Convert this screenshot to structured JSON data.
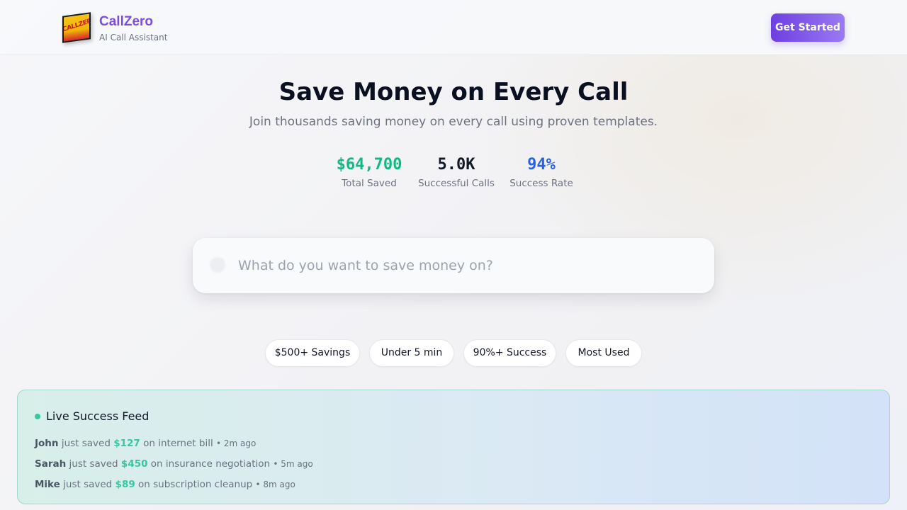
{
  "header": {
    "brand_name": "CallZero",
    "brand_tagline": "AI Call Assistant",
    "logo_text": "CALLZERO",
    "cta_label": "Get Started"
  },
  "hero": {
    "title": "Save Money on Every Call",
    "subtitle": "Join thousands saving money on every call using proven templates."
  },
  "stats": [
    {
      "value": "$64,700",
      "label": "Total Saved",
      "color": "#10b981"
    },
    {
      "value": "5.0K",
      "label": "Successful Calls",
      "color": "#111827"
    },
    {
      "value": "94%",
      "label": "Success Rate",
      "color": "#2563eb"
    }
  ],
  "search": {
    "placeholder": "What do you want to save money on?",
    "icon": "search-icon"
  },
  "filters": [
    {
      "label": "$500+ Savings"
    },
    {
      "label": "Under 5 min"
    },
    {
      "label": "90%+ Success"
    },
    {
      "label": "Most Used"
    }
  ],
  "feed": {
    "title": "Live Success Feed",
    "items": [
      {
        "name": "John",
        "verb": "just saved",
        "amount": "$127",
        "what": "on internet bill",
        "time": "• 2m ago"
      },
      {
        "name": "Sarah",
        "verb": "just saved",
        "amount": "$450",
        "what": "on insurance negotiation",
        "time": "• 5m ago"
      },
      {
        "name": "Mike",
        "verb": "just saved",
        "amount": "$89",
        "what": "on subscription cleanup",
        "time": "• 8m ago"
      }
    ]
  }
}
